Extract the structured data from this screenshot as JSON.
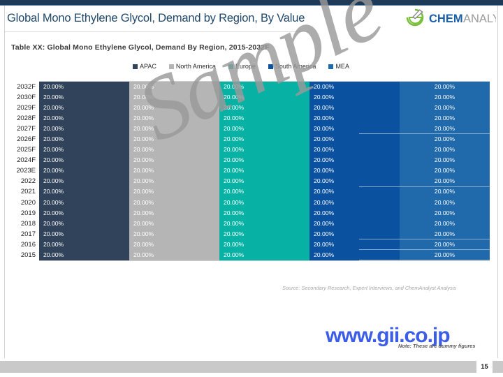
{
  "slide": {
    "title": "Global Mono Ethylene Glycol, Demand by Region, By Value",
    "page_number": "15",
    "watermark": "Sample",
    "source_note": "Source: Secondary Research, Expert Interviews, and ChemAnalyst Analysis",
    "dummy_note": "Note: These are dummy figures",
    "gii_url": "www.gii.co.jp"
  },
  "logo": {
    "name": "chemanalyst-logo",
    "text_primary": "CHEM",
    "text_secondary": "ANALYST",
    "color_primary": "#1b5fa8",
    "color_secondary": "#8e8e8e",
    "color_mark": "#7bbf3f"
  },
  "table": {
    "caption": "Table XX: Global  Mono Ethylene Glycol, Demand By Region, 2015-2032F"
  },
  "chart_data": {
    "type": "bar",
    "orientation": "horizontal",
    "stacked": true,
    "stack_mode": "100%",
    "title": "Global Mono Ethylene Glycol, Demand by Region, By Value",
    "xlabel": "",
    "ylabel": "",
    "xlim": [
      0,
      100
    ],
    "grid": true,
    "legend_position": "top",
    "value_format": "percent-2dp",
    "categories": [
      "2032F",
      "2030F",
      "2029F",
      "2028F",
      "2027F",
      "2026F",
      "2025F",
      "2024F",
      "2023E",
      "2022",
      "2021",
      "2020",
      "2019",
      "2018",
      "2017",
      "2016",
      "2015"
    ],
    "series": [
      {
        "name": "APAC",
        "color": "#31435a",
        "values": [
          20,
          20,
          20,
          20,
          20,
          20,
          20,
          20,
          20,
          20,
          20,
          20,
          20,
          20,
          20,
          20,
          20
        ],
        "labels": [
          "20.00%",
          "20.00%",
          "20.00%",
          "20.00%",
          "20.00%",
          "20.00%",
          "20.00%",
          "20.00%",
          "20.00%",
          "20.00%",
          "20.00%",
          "20.00%",
          "20.00%",
          "20.00%",
          "20.00%",
          "20.00%",
          "20.00%"
        ]
      },
      {
        "name": "North America",
        "color": "#b5b5b5",
        "values": [
          20,
          20,
          20,
          20,
          20,
          20,
          20,
          20,
          20,
          20,
          20,
          20,
          20,
          20,
          20,
          20,
          20
        ],
        "labels": [
          "20.00%",
          "20.00%",
          "20.00%",
          "20.00%",
          "20.00%",
          "20.00%",
          "20.00%",
          "20.00%",
          "20.00%",
          "20.00%",
          "20.00%",
          "20.00%",
          "20.00%",
          "20.00%",
          "20.00%",
          "20.00%",
          "20.00%"
        ]
      },
      {
        "name": "Europe",
        "color": "#07b2a4",
        "values": [
          20,
          20,
          20,
          20,
          20,
          20,
          20,
          20,
          20,
          20,
          20,
          20,
          20,
          20,
          20,
          20,
          20
        ],
        "labels": [
          "20.00%",
          "20.00%",
          "20.00%",
          "20.00%",
          "20.00%",
          "20.00%",
          "20.00%",
          "20.00%",
          "20.00%",
          "20.00%",
          "20.00%",
          "20.00%",
          "20.00%",
          "20.00%",
          "20.00%",
          "20.00%",
          "20.00%"
        ]
      },
      {
        "name": "South America",
        "color": "#0a52a0",
        "values": [
          20,
          20,
          20,
          20,
          20,
          20,
          20,
          20,
          20,
          20,
          20,
          20,
          20,
          20,
          20,
          20,
          20
        ],
        "labels": [
          "20.00%",
          "20.00%",
          "20.00%",
          "20.00%",
          "20.00%",
          "20.00%",
          "20.00%",
          "20.00%",
          "20.00%",
          "20.00%",
          "20.00%",
          "20.00%",
          "20.00%",
          "20.00%",
          "20.00%",
          "20.00%",
          "20.00%"
        ]
      },
      {
        "name": "MEA",
        "color": "#2069ab",
        "values": [
          20,
          20,
          20,
          20,
          20,
          20,
          20,
          20,
          20,
          20,
          20,
          20,
          20,
          20,
          20,
          20,
          20
        ],
        "labels": [
          "20.00%",
          "20.00%",
          "20.00%",
          "20.00%",
          "20.00%",
          "20.00%",
          "20.00%",
          "20.00%",
          "20.00%",
          "20.00%",
          "20.00%",
          "20.00%",
          "20.00%",
          "20.00%",
          "20.00%",
          "20.00%",
          "20.00%"
        ]
      }
    ]
  }
}
